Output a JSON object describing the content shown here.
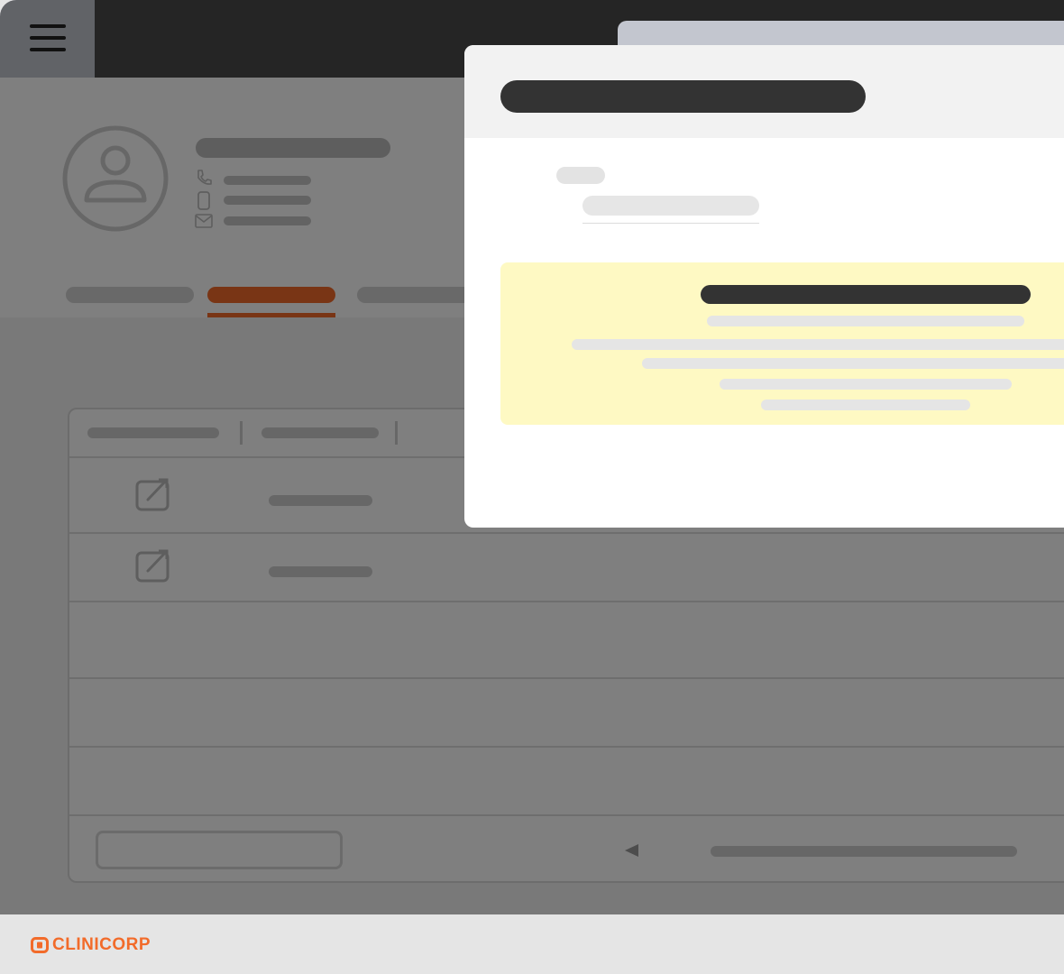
{
  "brand": {
    "name": "CLINICORP",
    "color": "#f26b2a"
  },
  "colors": {
    "active_tab": "#f26b2a",
    "modal_title_bar": "#333333",
    "notice_background": "#fef9c3",
    "placeholder": "#e3e3e3"
  },
  "icons": {
    "menu": "hamburger-icon",
    "avatar": "user-avatar-icon",
    "phone": "phone-icon",
    "mobile": "mobile-icon",
    "email": "envelope-icon",
    "edit": "edit-icon",
    "prev_page": "triangle-left-icon"
  },
  "profile": {
    "tabs": [
      "tab-1",
      "tab-2",
      "tab-3"
    ],
    "active_tab_index": 1
  }
}
